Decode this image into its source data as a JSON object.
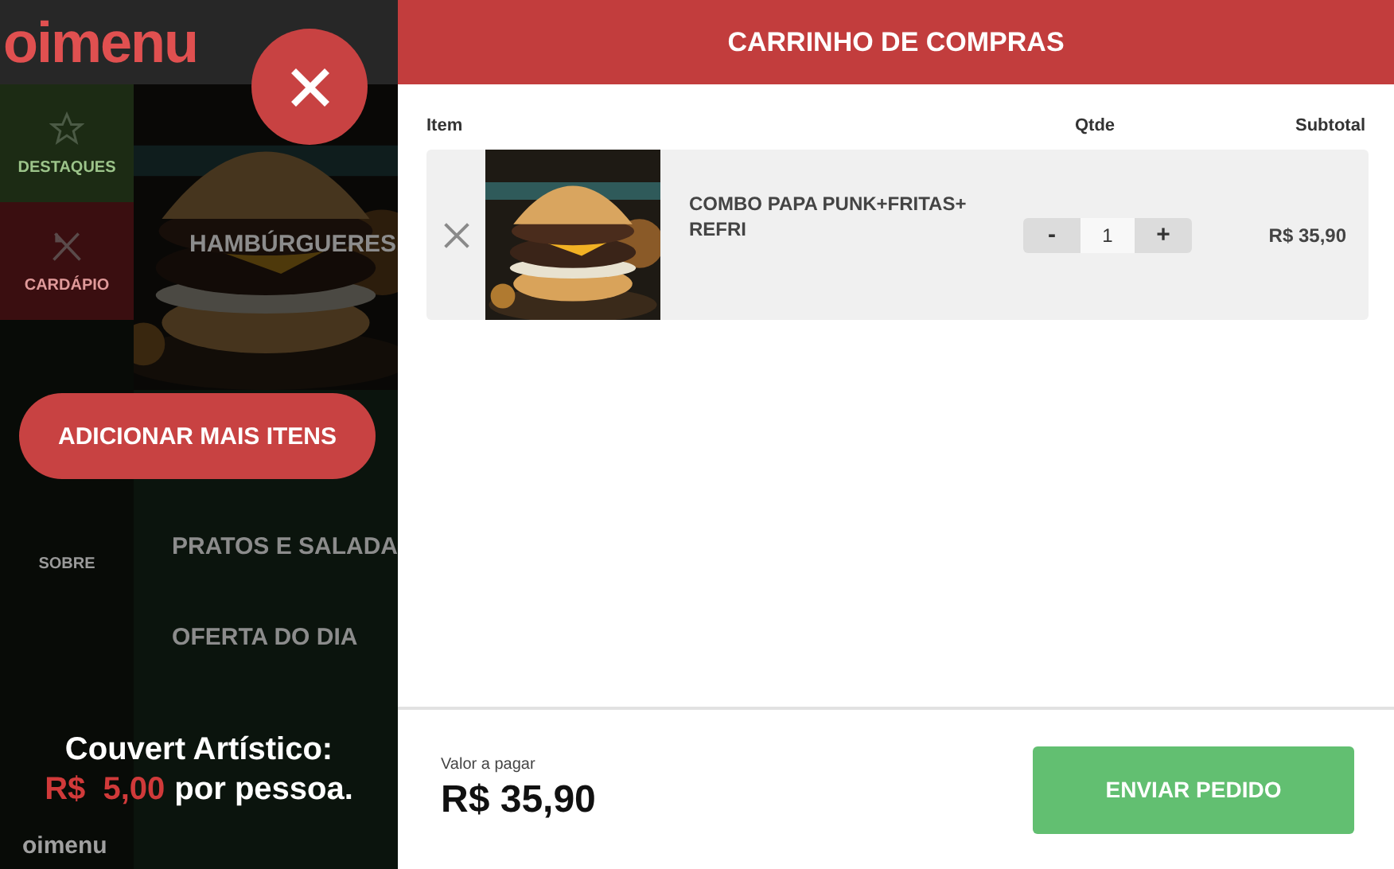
{
  "background_app": {
    "logo": "oimenu",
    "sidebar": [
      {
        "label": "DESTAQUES",
        "selected": false
      },
      {
        "label": "CARDÁPIO",
        "selected": true
      }
    ],
    "about_label": "SOBRE",
    "sections": [
      "HAMBÚRGUERES",
      "PRATOS E SALADA",
      "OFERTA DO DIA"
    ],
    "footer_logo": "oimenu"
  },
  "overlay": {
    "add_more_button": "ADICIONAR MAIS ITENS",
    "note_title": "Couvert Artístico:",
    "note_price": "R$  5,00",
    "note_suffix": "por pessoa."
  },
  "cart": {
    "title": "CARRINHO DE COMPRAS",
    "columns": [
      "Item",
      "Qtde",
      "Subtotal"
    ],
    "items": [
      {
        "name": "COMBO PAPA PUNK+FRITAS+ REFRI",
        "decrease": "-",
        "quantity": "1",
        "increase": "+",
        "subtotal": "R$ 35,90"
      }
    ],
    "total_label": "Valor a pagar",
    "total": "R$ 35,90",
    "send_button": "ENVIAR PEDIDO"
  }
}
